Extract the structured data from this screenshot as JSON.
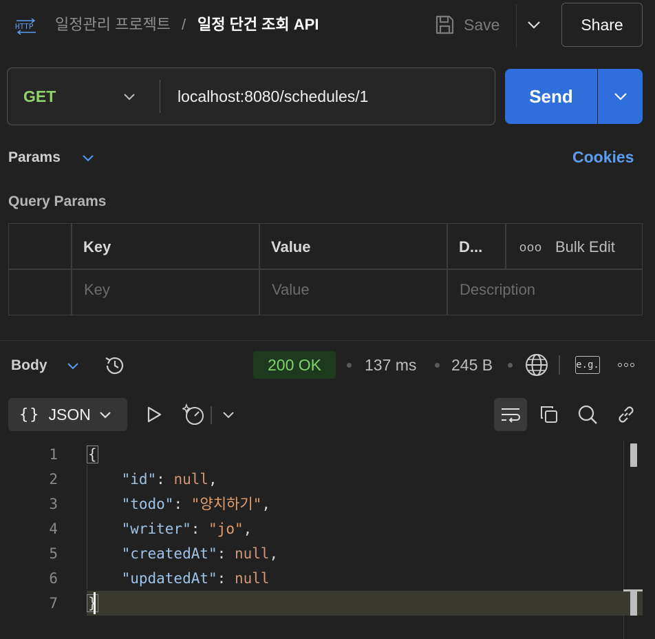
{
  "header": {
    "breadcrumb_parent": "일정관리 프로젝트",
    "breadcrumb_separator": "/",
    "title": "일정 단건 조회 API",
    "save_label": "Save",
    "share_label": "Share"
  },
  "request": {
    "method": "GET",
    "url": "localhost:8080/schedules/1",
    "send_label": "Send"
  },
  "params": {
    "tab_label": "Params",
    "cookies_label": "Cookies",
    "section_title": "Query Params",
    "columns": {
      "key": "Key",
      "value": "Value",
      "description": "D...",
      "bulk_edit": "Bulk Edit"
    },
    "placeholders": {
      "key": "Key",
      "value": "Value",
      "description": "Description"
    }
  },
  "response": {
    "tab_label": "Body",
    "status": "200 OK",
    "time": "137 ms",
    "size": "245 B",
    "eg_label": "e.g.",
    "format_label": "JSON",
    "status_color": "#7fd36a",
    "send_color": "#2f6fdb",
    "body_lines": [
      {
        "n": "1"
      },
      {
        "n": "2",
        "key": "\"id\"",
        "sep": ": ",
        "val": "null",
        "tail": ","
      },
      {
        "n": "3",
        "key": "\"todo\"",
        "sep": ": ",
        "val": "\"양치하기\"",
        "tail": ","
      },
      {
        "n": "4",
        "key": "\"writer\"",
        "sep": ": ",
        "val": "\"jo\"",
        "tail": ","
      },
      {
        "n": "5",
        "key": "\"createdAt\"",
        "sep": ": ",
        "val": "null",
        "tail": ","
      },
      {
        "n": "6",
        "key": "\"updatedAt\"",
        "sep": ": ",
        "val": "null",
        "tail": ""
      },
      {
        "n": "7"
      }
    ],
    "open_brace": "{",
    "close_brace": "}"
  }
}
